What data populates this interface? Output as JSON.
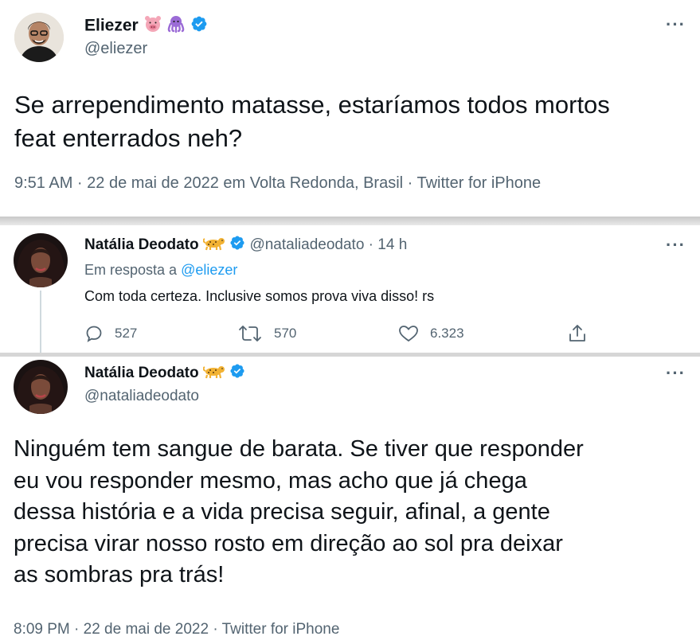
{
  "tweet1": {
    "name": "Eliezer",
    "handle": "@eliezer",
    "text_line1": "Se arrependimento matasse, estaríamos todos mortos",
    "text_line2": "feat enterrados neh?",
    "meta": "9:51 AM · 22 de mai de 2022 em Volta Redonda, Brasil · Twitter for iPhone",
    "name_emojis": [
      "pig-face-icon",
      "octopus-icon"
    ]
  },
  "reply": {
    "name": "Natália Deodato",
    "handle_time": "@nataliadeodato · 14 h",
    "reply_prefix": "Em resposta a",
    "reply_to": "@eliezer",
    "text": "Com toda certeza. Inclusive somos prova viva disso! rs",
    "stats": {
      "replies": "527",
      "retweets": "570",
      "likes": "6.323"
    },
    "name_emoji": "leopard-icon"
  },
  "tweet2": {
    "name": "Natália Deodato",
    "handle": "@nataliadeodato",
    "text_lines": [
      "Ninguém tem sangue de barata. Se tiver que responder",
      "eu vou responder mesmo, mas acho que já chega",
      "dessa história e a vida precisa seguir, afinal, a gente",
      "precisa virar nosso rosto em direção ao sol pra deixar",
      "as sombras pra trás!"
    ],
    "meta": "8:09 PM · 22 de mai de 2022 · Twitter for iPhone",
    "name_emoji": "leopard-icon"
  },
  "colors": {
    "verified": "#1d9bf0",
    "secondary": "#536471",
    "link": "#1d9bf0",
    "text": "#0f1419"
  }
}
